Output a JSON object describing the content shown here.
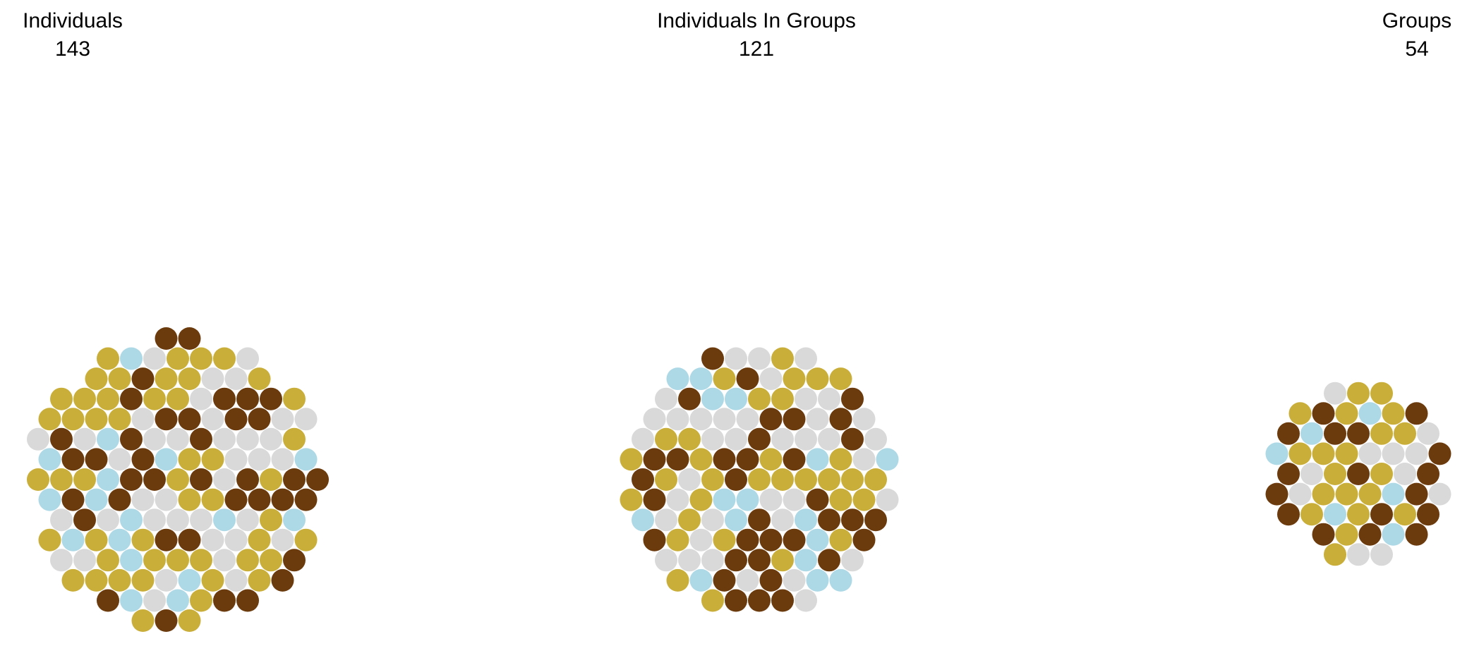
{
  "chart_data": {
    "type": "packed-bubble",
    "colors": {
      "gold": "#c9ae3a",
      "brown": "#6b3a0d",
      "gray": "#d9d9d9",
      "blue": "#add8e6"
    },
    "panels": [
      {
        "title": "Individuals",
        "count": "143",
        "categories": [
          {
            "color": "gold",
            "count": 50
          },
          {
            "color": "brown",
            "count": 38
          },
          {
            "color": "gray",
            "count": 38
          },
          {
            "color": "blue",
            "count": 17
          }
        ]
      },
      {
        "title": "Individuals In Groups",
        "count": "121",
        "categories": [
          {
            "color": "gold",
            "count": 32
          },
          {
            "color": "brown",
            "count": 35
          },
          {
            "color": "gray",
            "count": 38
          },
          {
            "color": "blue",
            "count": 16
          }
        ]
      },
      {
        "title": "Groups",
        "count": "54",
        "categories": [
          {
            "color": "gold",
            "count": 20
          },
          {
            "color": "brown",
            "count": 17
          },
          {
            "color": "gray",
            "count": 11
          },
          {
            "color": "blue",
            "count": 6
          }
        ]
      }
    ]
  }
}
